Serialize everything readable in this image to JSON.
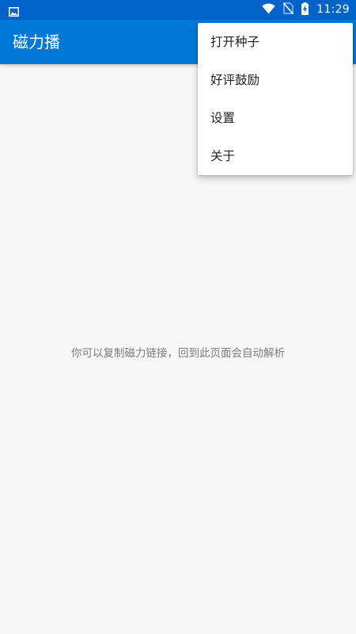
{
  "status_bar": {
    "time": "11:29",
    "icons": [
      "image-notification-icon",
      "wifi-icon",
      "no-sim-icon",
      "battery-charging-icon"
    ]
  },
  "app_bar": {
    "title": "磁力播"
  },
  "overflow_menu": {
    "items": [
      {
        "label": "打开种子"
      },
      {
        "label": "好评鼓励"
      },
      {
        "label": "设置"
      },
      {
        "label": "关于"
      }
    ]
  },
  "main": {
    "empty_message": "你可以复制磁力链接，回到此页面会自动解析"
  },
  "colors": {
    "status_bar": "#0063c9",
    "app_bar": "#0078d7",
    "background": "#f7f7f7",
    "menu_background": "#ffffff",
    "menu_text": "#222222",
    "hint_text": "#7c7c7c"
  }
}
